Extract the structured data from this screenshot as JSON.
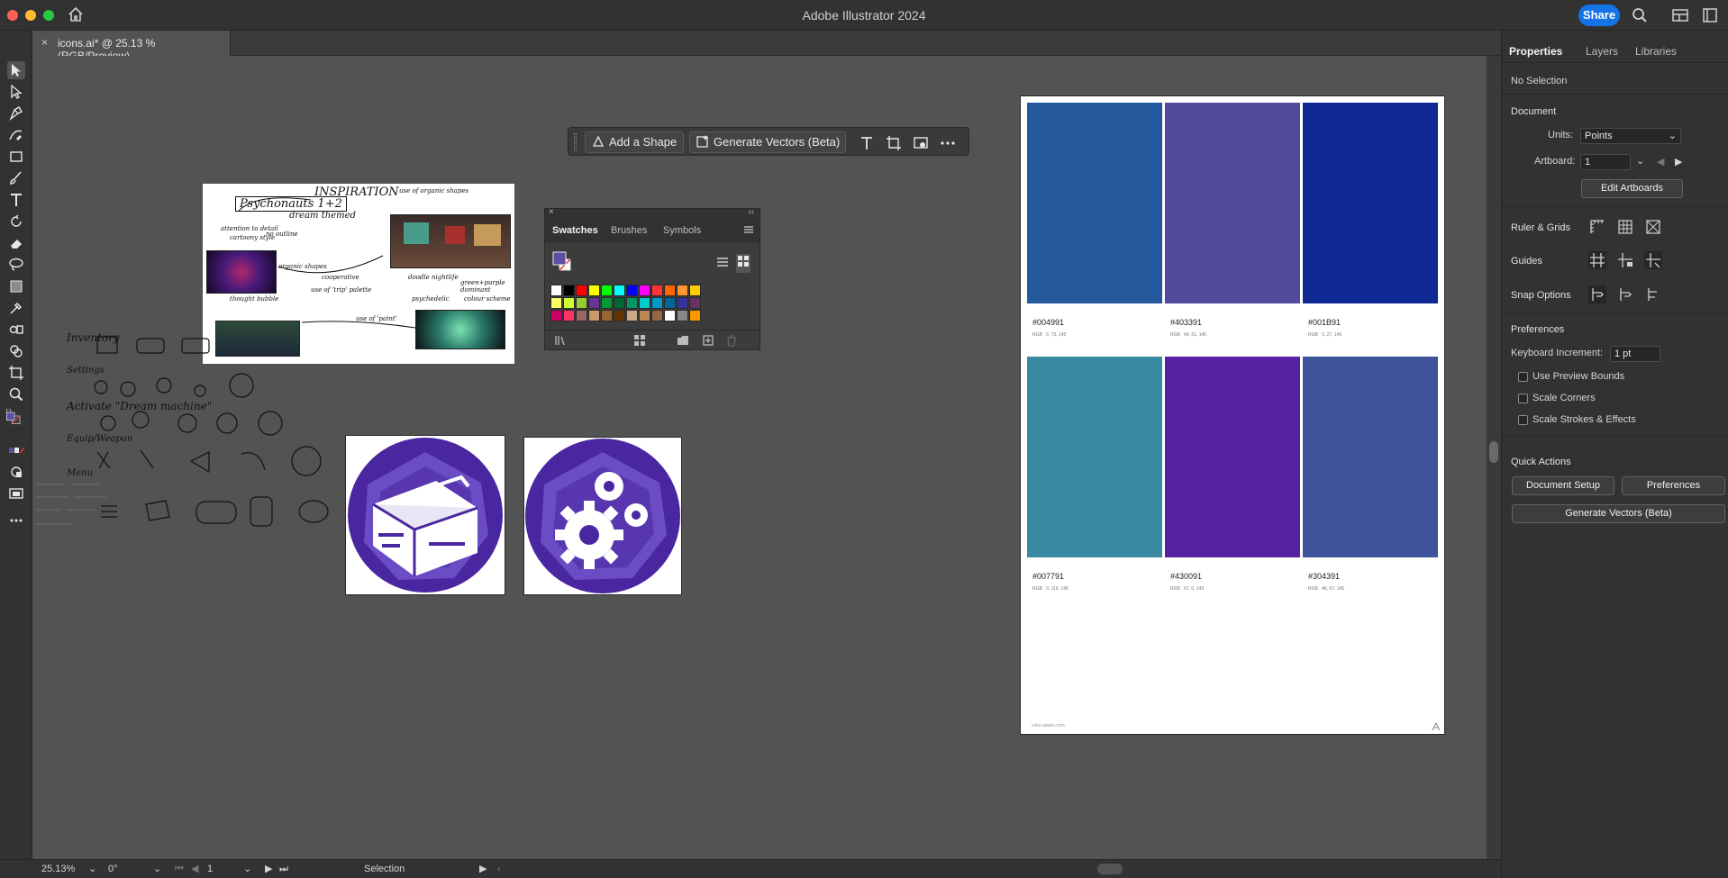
{
  "window": {
    "title": "Adobe Illustrator 2024",
    "share_label": "Share"
  },
  "document_tab": {
    "label": "icons.ai* @ 25.13 % (RGB/Preview)",
    "close": "×"
  },
  "context_bar": {
    "add_shape": "Add a Shape",
    "generate_vectors": "Generate Vectors (Beta)"
  },
  "swatches_panel": {
    "tabs": [
      "Swatches",
      "Brushes",
      "Symbols"
    ],
    "colors": [
      "#ffffff",
      "#000000",
      "#ff0000",
      "#ffff00",
      "#00ff00",
      "#00ffff",
      "#0000ff",
      "#ff00ff",
      "#ff3333",
      "#ff6600",
      "#ff9933",
      "#ffcc00",
      "#ffff66",
      "#ccff33",
      "#99cc33",
      "#663399",
      "#009933",
      "#006633",
      "#009966",
      "#00cccc",
      "#0099cc",
      "#006699",
      "#333399",
      "#663366",
      "#cc0066",
      "#ff3366",
      "#996666",
      "#cc9966",
      "#996633",
      "#663300",
      "#ccaa88",
      "#bb8855",
      "#996644",
      "#ffffff",
      "#888888",
      "#ff9900"
    ]
  },
  "sketch": {
    "title": "INSPIRATION",
    "subtitle": "Psychonauts 1+2",
    "dream": "dream themed",
    "notes": [
      "attention to detail",
      "cartoony style",
      "no outline",
      "organic shapes",
      "thought bubble",
      "use of 'trip' palette",
      "cooperative",
      "doodle nightlife",
      "use of 'paint'",
      "green+purple dominant",
      "colour scheme",
      "psychedelic",
      "use of organic shapes"
    ]
  },
  "doodles": {
    "inventory": "Inventory",
    "settings": "Settings",
    "activate": "Activate \"Dream machine\"",
    "equip": "Equip/Weapon",
    "menu": "Menu"
  },
  "palette": {
    "swatches": [
      {
        "hex": "#004991",
        "rgb": "0, 73, 145",
        "color": "#23589c"
      },
      {
        "hex": "#403391",
        "rgb": "64, 51, 145",
        "color": "#514a9d"
      },
      {
        "hex": "#001B91",
        "rgb": "0, 27, 145",
        "color": "#102a95"
      },
      {
        "hex": "#007791",
        "rgb": "0, 119, 145",
        "color": "#3a8aa3"
      },
      {
        "hex": "#430091",
        "rgb": "67, 0, 145",
        "color": "#5622a1"
      },
      {
        "hex": "#304391",
        "rgb": "48, 67, 145",
        "color": "#3f539c"
      }
    ],
    "rgb_label": "RGB",
    "footer": "color.adobe.com"
  },
  "properties": {
    "tabs": [
      "Properties",
      "Layers",
      "Libraries"
    ],
    "selection": "No Selection",
    "document_heading": "Document",
    "units_label": "Units:",
    "units_value": "Points",
    "artboard_label": "Artboard:",
    "artboard_value": "1",
    "edit_artboards": "Edit Artboards",
    "ruler_grids": "Ruler & Grids",
    "guides": "Guides",
    "snap_options": "Snap Options",
    "preferences_heading": "Preferences",
    "keyboard_increment_label": "Keyboard Increment:",
    "keyboard_increment_value": "1 pt",
    "use_preview_bounds": "Use Preview Bounds",
    "scale_corners": "Scale Corners",
    "scale_strokes": "Scale Strokes & Effects",
    "quick_actions": "Quick Actions",
    "document_setup": "Document Setup",
    "preferences_btn": "Preferences",
    "generate_vectors": "Generate Vectors (Beta)"
  },
  "status": {
    "zoom": "25.13%",
    "rotation": "0°",
    "artboard": "1",
    "tool": "Selection"
  }
}
